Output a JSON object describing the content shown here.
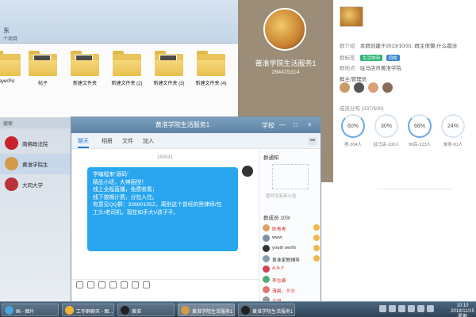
{
  "explorer": {
    "title": "东",
    "subtitle": "个项目",
    "folders": [
      {
        "label": "layerPic"
      },
      {
        "label": "帖子"
      },
      {
        "label": "新建文件夹"
      },
      {
        "label": "新建文件夹 (2)"
      },
      {
        "label": "新建文件夹 (3)"
      },
      {
        "label": "新建文件夹 (4)"
      }
    ]
  },
  "group_profile": {
    "name": "莆淮学院生活服务1",
    "number": "284415314",
    "intro_label": "群介绍",
    "intro_text": "本群创建于2013/10/31: 群主很懒,什么都没",
    "category_label": "群标签",
    "tags": [
      "生活休闲",
      "同校"
    ],
    "location_label": "群地点",
    "location": "驻马店市黄淮学院",
    "members_label": "群主/管理员",
    "stats_title": "成员分布 (337/500)",
    "stats": [
      {
        "value": "60%",
        "label": "男-204人"
      },
      {
        "value": "30%",
        "label": "驻马店-103人"
      },
      {
        "value": "66%",
        "label": "90后-223人"
      },
      {
        "value": "24%",
        "label": "单身-81人"
      }
    ]
  },
  "qq_list": {
    "search_placeholder": "搜索",
    "contacts": [
      {
        "name": "南佛政法院"
      },
      {
        "name": "黄淮学院生"
      },
      {
        "name": "大同大学"
      }
    ]
  },
  "chat": {
    "title": "黄淮学院生活服务1",
    "controls": [
      "学校",
      "—",
      "□",
      "×"
    ],
    "tabs": [
      "聊天",
      "相册",
      "文件",
      "加入"
    ],
    "more": "•••",
    "date": "180531",
    "message_lines": [
      "学编程来“源码”",
      "",
      "",
      "精品小班，大神面授！",
      "线上全程直播，免费收看；",
      "线下按期计费，分包入住。",
      "有意见QQ群：32680105Z，离别这个曾经的黑律师/包",
      "工头/老司机，现在如手大V孩子手。"
    ],
    "side": {
      "notice_title": "群通知",
      "notice_empty": "暂时没有新公告",
      "members_title": "群成员 103/",
      "members": [
        {
          "name": "陈青青"
        },
        {
          "name": "www"
        },
        {
          "name": "youth  worth"
        },
        {
          "name": "黄淮家教辅导"
        },
        {
          "name": "A.N.Y"
        },
        {
          "name": "李志康"
        },
        {
          "name": "清晨、夕沙"
        },
        {
          "name": "王琪"
        }
      ]
    }
  },
  "taskbar": {
    "items": [
      {
        "label": "画 - 图片"
      },
      {
        "label": "工作群聊天 - 图..."
      },
      {
        "label": "黄淮"
      },
      {
        "label": "黄淮学院生活服务1"
      },
      {
        "label": "黄淮学院生活服务1"
      }
    ],
    "clock_time": "10:10",
    "clock_date": "2018/11/15 星期"
  },
  "colors": {
    "accent": "#2aa6ef",
    "profile_bg": "#9b8d78",
    "tag_green": "#2bb673",
    "tag_blue": "#3a86d1"
  }
}
